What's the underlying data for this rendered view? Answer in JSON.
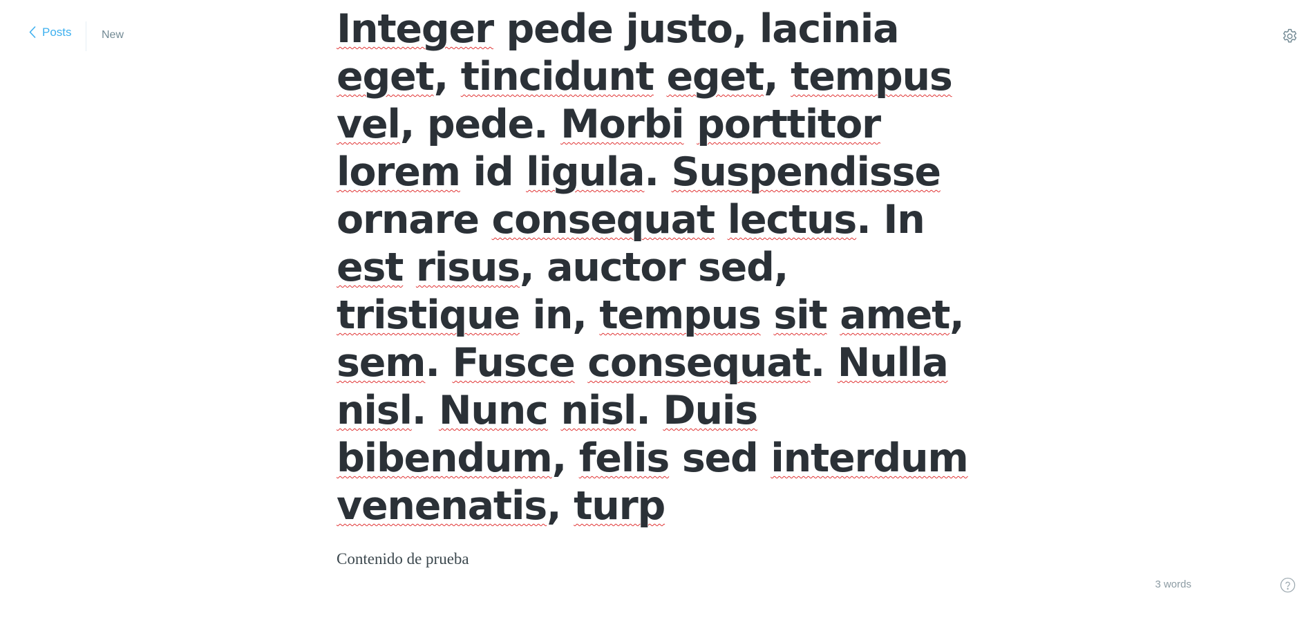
{
  "header": {
    "back_label": "Posts",
    "status_label": "New",
    "back_icon": "chevron-left-icon",
    "settings_icon": "gear-icon"
  },
  "editor": {
    "title": "Integer pede justo, lacinia eget, tincidunt eget, tempus vel, pede. Morbi porttitor lorem id ligula. Suspendisse ornare consequat lectus. In est risus, auctor sed, tristique in, tempus sit amet, sem. Fusce consequat. Nulla nisl. Nunc nisl. Duis bibendum, felis sed interdum venenatis, turp",
    "body": "Contenido de prueba"
  },
  "footer": {
    "word_count": "3 words",
    "help_icon": "question-circle-icon"
  },
  "colors": {
    "accent": "#3eb0ef",
    "text": "#2b3137",
    "muted": "#738a94",
    "spellcheck": "#e03232"
  }
}
